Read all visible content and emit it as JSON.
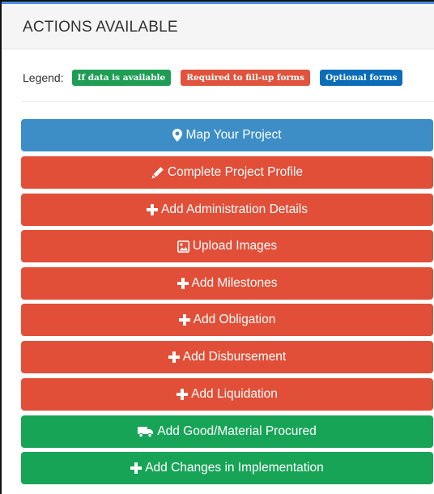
{
  "panel": {
    "title": "ACTIONS AVAILABLE"
  },
  "legend": {
    "label": "Legend:",
    "badges": [
      {
        "text": "If data is available",
        "color": "#1f9d55"
      },
      {
        "text": "Required to fill-up forms",
        "color": "#e0533c"
      },
      {
        "text": "Optional forms",
        "color": "#0b6db8"
      }
    ]
  },
  "actions": [
    {
      "label": "Map Your Project",
      "icon": "map-marker-icon",
      "color": "#3d8ec6"
    },
    {
      "label": "Complete Project Profile",
      "icon": "pencil-icon",
      "color": "#e14f38"
    },
    {
      "label": "Add Administration Details",
      "icon": "plus-icon",
      "color": "#e14f38"
    },
    {
      "label": "Upload Images",
      "icon": "image-icon",
      "color": "#e14f38"
    },
    {
      "label": "Add Milestones",
      "icon": "plus-icon",
      "color": "#e14f38"
    },
    {
      "label": "Add Obligation",
      "icon": "plus-icon",
      "color": "#e14f38"
    },
    {
      "label": "Add Disbursement",
      "icon": "plus-icon",
      "color": "#e14f38"
    },
    {
      "label": "Add Liquidation",
      "icon": "plus-icon",
      "color": "#e14f38"
    },
    {
      "label": "Add Good/Material Procured",
      "icon": "truck-icon",
      "color": "#18a457"
    },
    {
      "label": "Add Changes in Implementation",
      "icon": "plus-icon",
      "color": "#18a457"
    }
  ]
}
